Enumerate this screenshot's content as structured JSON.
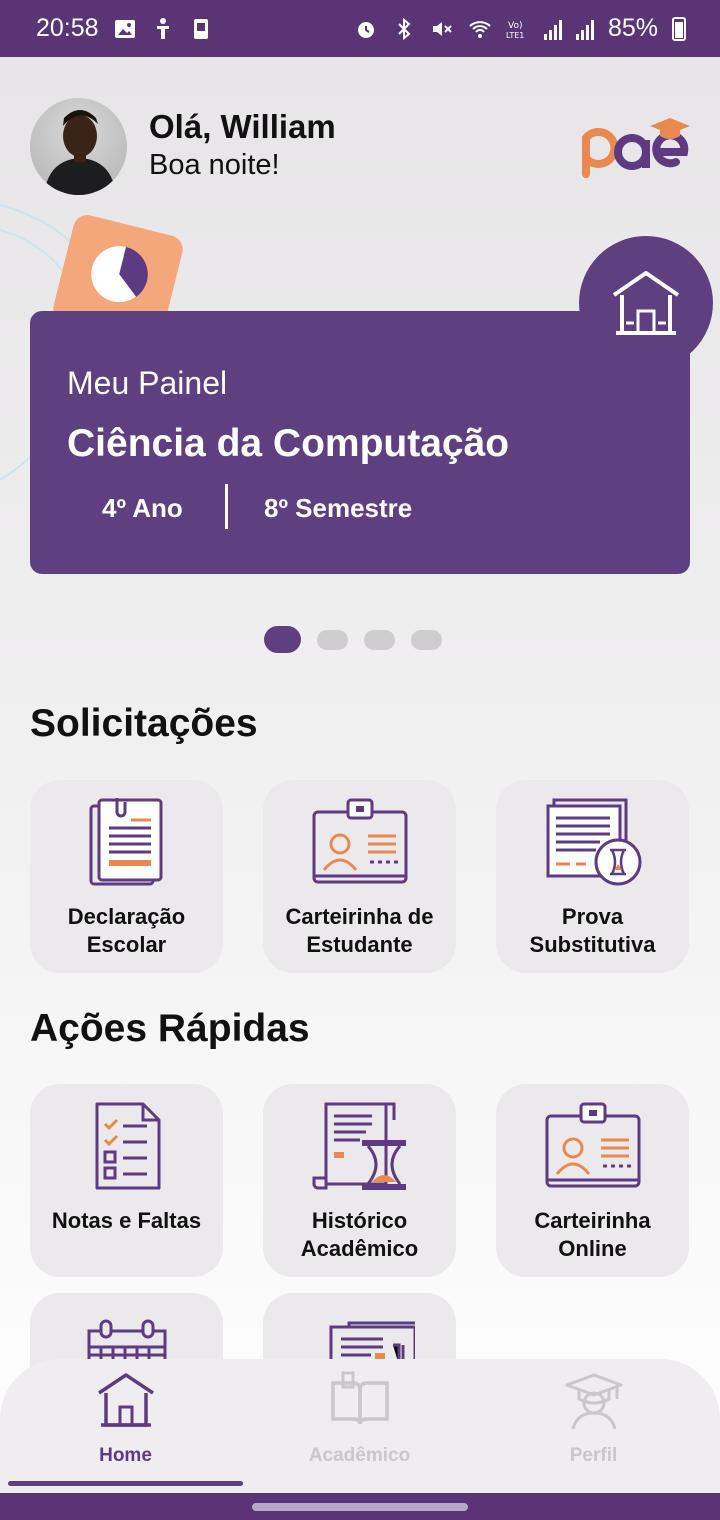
{
  "status_bar": {
    "time": "20:58",
    "battery": "85%",
    "icons": [
      "gallery-icon",
      "accessibility-icon",
      "sim-icon",
      "alarm-icon",
      "bluetooth-icon",
      "mute-icon",
      "wifi-icon",
      "volte-icon",
      "signal-icon",
      "signal-icon",
      "battery-icon"
    ]
  },
  "header": {
    "greeting": "Olá, William",
    "subtitle": "Boa noite!",
    "logo_text": "pae"
  },
  "panel": {
    "title": "Meu Painel",
    "course": "Ciência da Computação",
    "year": "4º Ano",
    "semester": "8º Semestre"
  },
  "carousel": {
    "pages": 4,
    "active_index": 0
  },
  "solicitacoes": {
    "title": "Solicitações",
    "items": [
      {
        "label": "Declaração Escolar",
        "icon": "document-clip-icon"
      },
      {
        "label": "Carteirinha de Estudante",
        "icon": "id-card-icon"
      },
      {
        "label": "Prova Substitutiva",
        "icon": "exam-hourglass-icon"
      }
    ]
  },
  "acoes": {
    "title": "Ações Rápidas",
    "items": [
      {
        "label": "Notas e Faltas",
        "icon": "checklist-icon"
      },
      {
        "label": "Histórico Acadêmico",
        "icon": "history-hourglass-icon"
      },
      {
        "label": "Carteirinha Online",
        "icon": "id-card-icon"
      },
      {
        "label": "",
        "icon": "calendar-icon"
      },
      {
        "label": "",
        "icon": "newspaper-icon"
      }
    ]
  },
  "bottom_nav": {
    "items": [
      {
        "label": "Home",
        "icon": "house-icon",
        "active": true
      },
      {
        "label": "Acadêmico",
        "icon": "book-icon",
        "active": false
      },
      {
        "label": "Perfil",
        "icon": "graduate-icon",
        "active": false
      }
    ]
  },
  "colors": {
    "brand_purple": "#5e4080",
    "accent_orange": "#e8894f",
    "status_bar": "#5a3575"
  }
}
